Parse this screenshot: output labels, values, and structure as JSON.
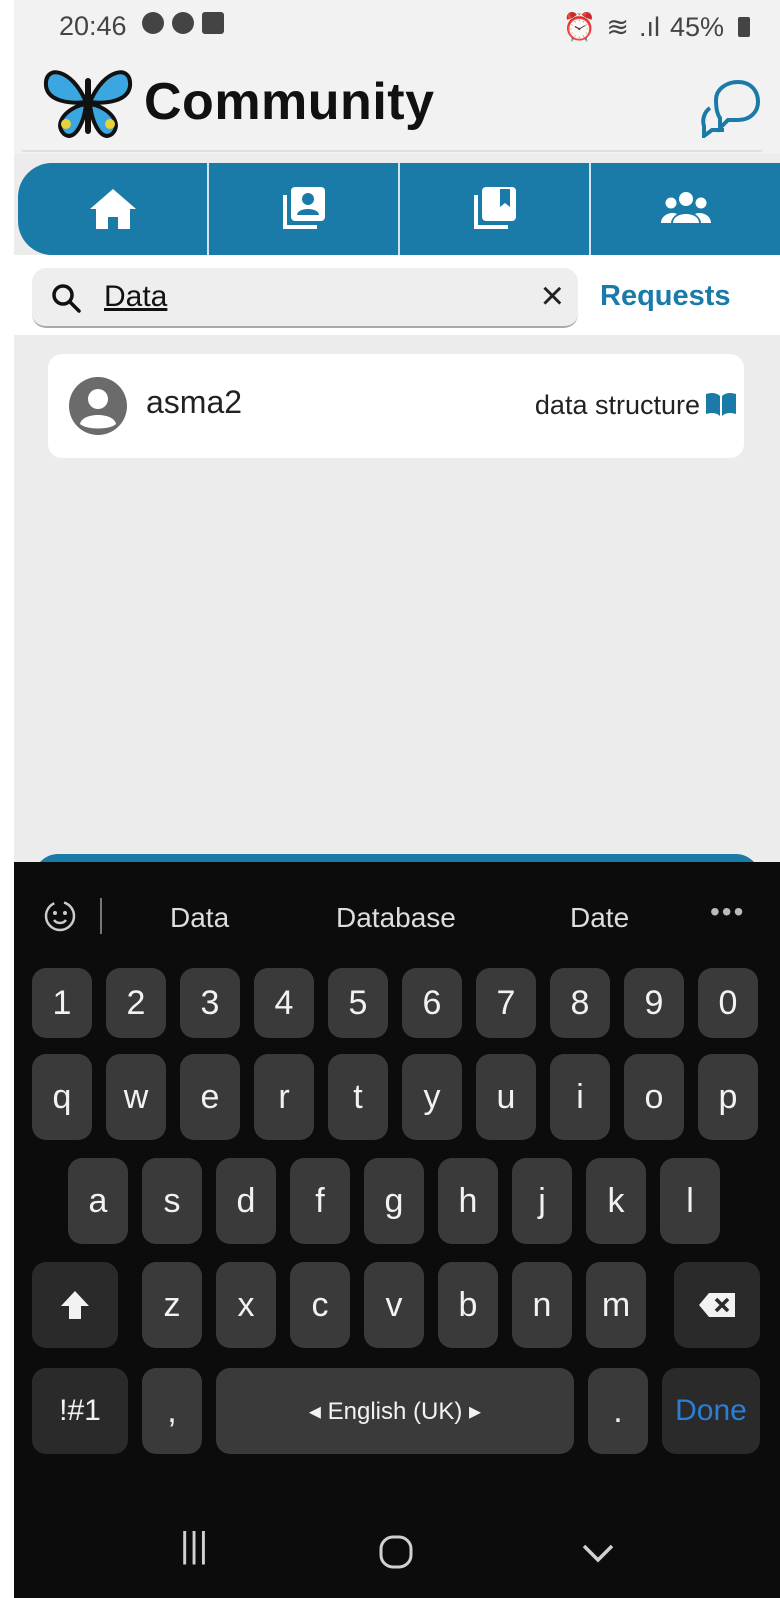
{
  "status_bar": {
    "time": "20:46",
    "battery": "45%"
  },
  "header": {
    "title": "Community"
  },
  "nav_tabs": [
    {
      "name": "home",
      "icon": "home-icon"
    },
    {
      "name": "portfolio",
      "icon": "profile-stack-icon"
    },
    {
      "name": "bookmarks",
      "icon": "bookmark-stack-icon"
    },
    {
      "name": "community",
      "icon": "group-icon"
    }
  ],
  "search": {
    "value": "Data",
    "requests_label": "Requests"
  },
  "results": [
    {
      "user": "asma2",
      "course": "data structure"
    }
  ],
  "keyboard": {
    "suggestions": [
      "Data",
      "Database",
      "Date"
    ],
    "more": "•••",
    "row_numbers": [
      "1",
      "2",
      "3",
      "4",
      "5",
      "6",
      "7",
      "8",
      "9",
      "0"
    ],
    "row1": [
      "q",
      "w",
      "e",
      "r",
      "t",
      "y",
      "u",
      "i",
      "o",
      "p"
    ],
    "row2": [
      "a",
      "s",
      "d",
      "f",
      "g",
      "h",
      "j",
      "k",
      "l"
    ],
    "row3": [
      "z",
      "x",
      "c",
      "v",
      "b",
      "n",
      "m"
    ],
    "symbols_label": "!#1",
    "comma": ",",
    "space_label": "◂ English (UK) ▸",
    "period": ".",
    "done_label": "Done"
  },
  "system_nav": {
    "recent": "|||",
    "home": "◯",
    "back": "⌄"
  },
  "colors": {
    "accent": "#1a7ba8",
    "keyboard_bg": "#0c0c0c",
    "key_bg": "#3a3a3a",
    "done_blue": "#2a7fd3"
  }
}
